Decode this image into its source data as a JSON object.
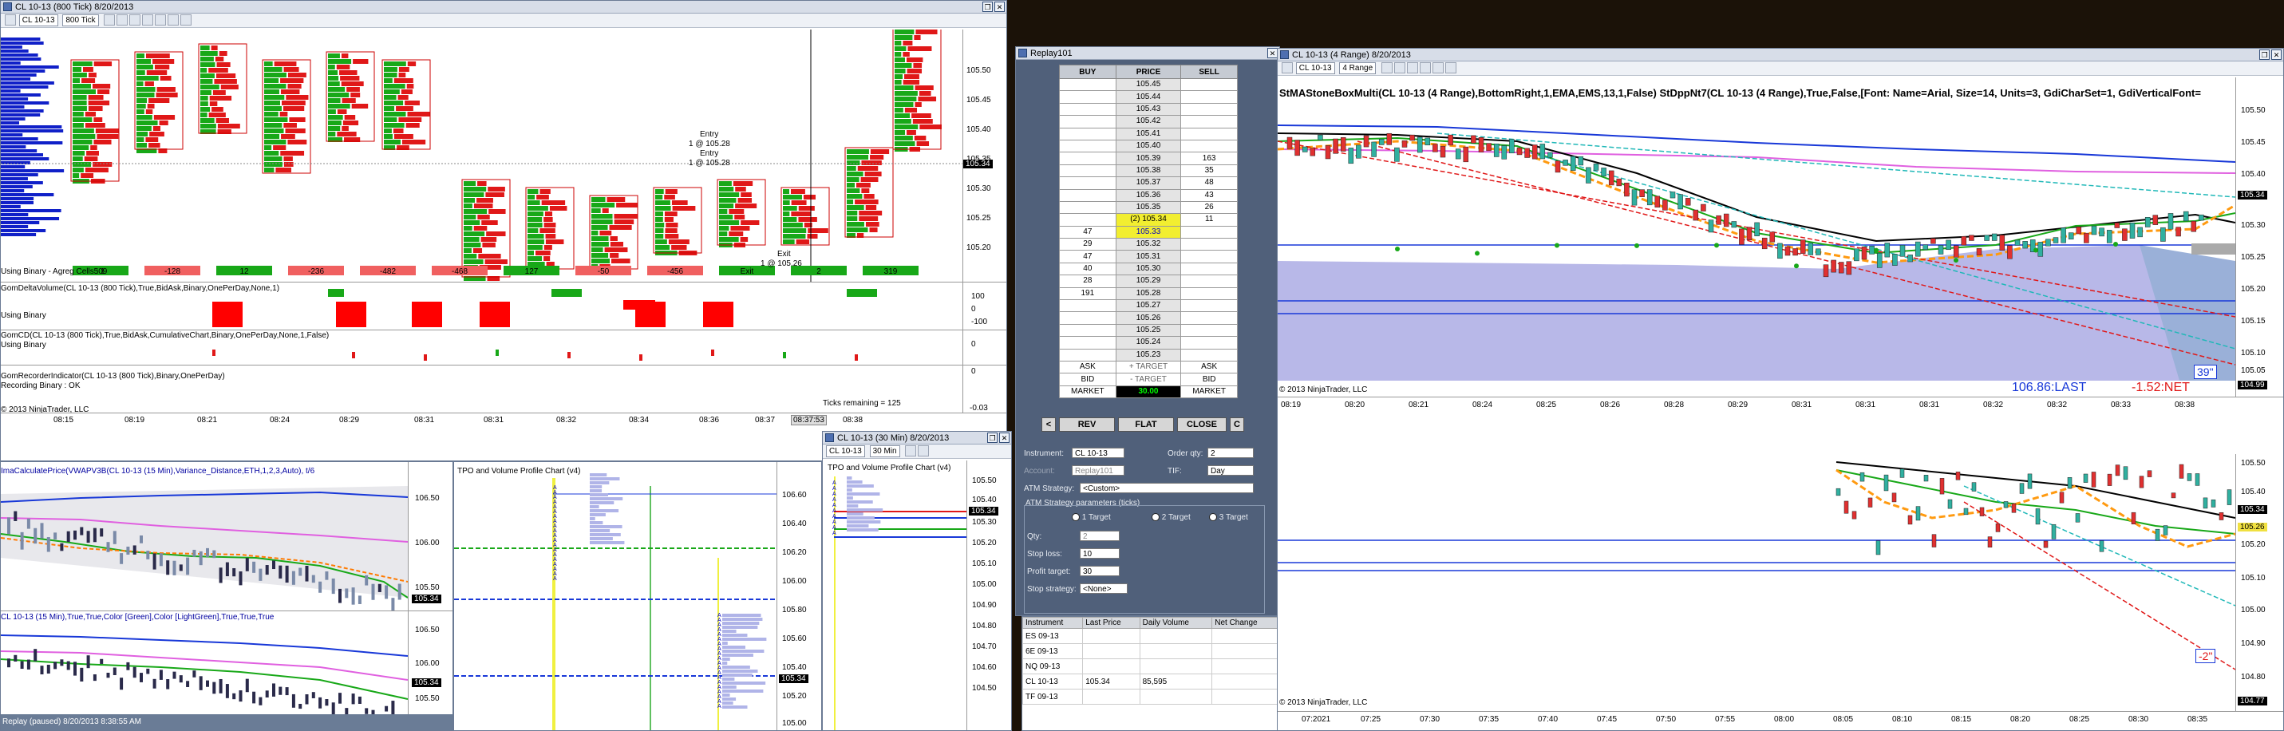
{
  "w1": {
    "title": "CL 10-13 (800 Tick)  8/20/2013",
    "instrument": "CL 10-13",
    "period": "800 Tick",
    "prices": [
      "105.50",
      "105.45",
      "105.40",
      "105.35",
      "105.30",
      "105.25",
      "105.20"
    ],
    "last_price": "105.34",
    "entry_text": [
      "Entry",
      "1 @ 105.28",
      "Entry",
      "1 @ 105.28"
    ],
    "exit_text": [
      "Exit",
      "1 @ 105.26"
    ],
    "row_label": "Using Binary - Agreg Cells : 1",
    "bar_values": [
      "509",
      "-128",
      "12",
      "-236",
      "-482",
      "-468",
      "127",
      "-50",
      "-456",
      "Exit",
      "2",
      "319"
    ],
    "ind1_label": "GomDeltaVolume(CL 10-13 (800 Tick),True,BidAsk,Binary,OnePerDay,None,1)",
    "ind1_sub": "Using Binary",
    "ind1_axis": [
      "100",
      "0",
      "-100"
    ],
    "ind2_label": "GomCD(CL 10-13 (800 Tick),True,BidAsk,CumulativeChart,Binary,OnePerDay,None,1,False)",
    "ind2_sub": "Using Binary",
    "ind2_axis": [
      "0"
    ],
    "ind3_label": "GomRecorderIndicator(CL 10-13 (800 Tick),Binary,OnePerDay)",
    "ind3_sub": "Recording Binary : OK",
    "ticks_remaining": "Ticks remaining = 125",
    "copyright": "© 2013 NinjaTrader, LLC",
    "ind3_axis": [
      "0",
      "-0.03"
    ],
    "times": [
      "08:15",
      "08:19",
      "08:21",
      "08:24",
      "08:29",
      "08:31",
      "08:31",
      "08:32",
      "08:34",
      "08:36",
      "08:37",
      "08:38"
    ],
    "cursor_time": "08:37:53"
  },
  "w2": {
    "title": "CL 10-13 (15 Min)",
    "label": "ImaCalculatePrice(VWAPV3B(CL 10-13 (15 Min),Variance_Distance,ETH,1,2,3,Auto),  t/6",
    "prices": [
      "106.50",
      "106.00",
      "105.50"
    ],
    "last_price": "105.34",
    "label2": "CL 10-13 (15 Min),True,True,Color [Green],Color [LightGreen],True,True,True",
    "prices2": [
      "106.50",
      "106.00",
      "105.50"
    ],
    "last_price2": "105.34",
    "status": "Replay (paused) 8/20/2013 8:38:55 AM"
  },
  "w3": {
    "label": "TPO and Volume Profile Chart (v4)",
    "prices": [
      "106.60",
      "106.40",
      "106.20",
      "106.00",
      "105.80",
      "105.60",
      "105.40",
      "105.20",
      "105.00"
    ],
    "last_price": "105.34"
  },
  "w4": {
    "title": "CL 10-13 (30 Min)  8/20/2013",
    "instrument": "CL 10-13",
    "period": "30 Min",
    "label": "TPO and Volume Profile Chart (v4)",
    "prices": [
      "105.50",
      "105.40",
      "105.30",
      "105.20",
      "105.10",
      "105.00",
      "104.90",
      "104.80",
      "104.70",
      "104.60",
      "104.50"
    ],
    "last_price": "105.34"
  },
  "replay": {
    "title": "Replay101",
    "headers": [
      "BUY",
      "PRICE",
      "SELL"
    ],
    "rows": [
      {
        "buy": "",
        "price": "105.45",
        "sell": ""
      },
      {
        "buy": "",
        "price": "105.44",
        "sell": ""
      },
      {
        "buy": "",
        "price": "105.43",
        "sell": ""
      },
      {
        "buy": "",
        "price": "105.42",
        "sell": ""
      },
      {
        "buy": "",
        "price": "105.41",
        "sell": ""
      },
      {
        "buy": "",
        "price": "105.40",
        "sell": ""
      },
      {
        "buy": "",
        "price": "105.39",
        "sell": "163"
      },
      {
        "buy": "",
        "price": "105.38",
        "sell": "35"
      },
      {
        "buy": "",
        "price": "105.37",
        "sell": "48"
      },
      {
        "buy": "",
        "price": "105.36",
        "sell": "43"
      },
      {
        "buy": "",
        "price": "105.35",
        "sell": "26"
      },
      {
        "buy": "",
        "price": "(2) 105.34",
        "sell": "11"
      },
      {
        "buy": "47",
        "price": "105.33",
        "sell": ""
      },
      {
        "buy": "29",
        "price": "105.32",
        "sell": ""
      },
      {
        "buy": "47",
        "price": "105.31",
        "sell": ""
      },
      {
        "buy": "40",
        "price": "105.30",
        "sell": ""
      },
      {
        "buy": "28",
        "price": "105.29",
        "sell": ""
      },
      {
        "buy": "191",
        "price": "105.28",
        "sell": ""
      },
      {
        "buy": "",
        "price": "105.27",
        "sell": ""
      },
      {
        "buy": "",
        "price": "105.26",
        "sell": ""
      },
      {
        "buy": "",
        "price": "105.25",
        "sell": ""
      },
      {
        "buy": "",
        "price": "105.24",
        "sell": ""
      },
      {
        "buy": "",
        "price": "105.23",
        "sell": ""
      }
    ],
    "ask_label": "ASK",
    "target_label": "+ TARGET",
    "bid_label": "BID",
    "target_label2": "- TARGET",
    "market_label": "MARKET",
    "position": "30.00",
    "rev": "REV",
    "flat": "FLAT",
    "close": "CLOSE",
    "left_arrow": "<",
    "c_label": "C",
    "instrument_label": "Instrument:",
    "instrument": "CL 10-13",
    "order_qty_label": "Order qty:",
    "order_qty": "2",
    "account_label": "Account:",
    "account": "Replay101",
    "tif_label": "TIF:",
    "tif": "Day",
    "atm_label": "ATM Strategy:",
    "atm": "<Custom>",
    "atm_params": "ATM Strategy parameters (ticks)",
    "targets": [
      "1 Target",
      "2 Target",
      "3 Target"
    ],
    "qty_label": "Qty:",
    "qty": "2",
    "stop_label": "Stop loss:",
    "stop": "10",
    "profit_label": "Profit target:",
    "profit": "30",
    "stopstrat_label": "Stop strategy:",
    "stopstrat": "<None>"
  },
  "quotes": {
    "headers": [
      "Instrument",
      "Last Price",
      "Daily Volume",
      "Net Change"
    ],
    "rows": [
      {
        "inst": "ES 09-13",
        "last": "",
        "vol": ""
      },
      {
        "inst": "6E 09-13",
        "last": "",
        "vol": ""
      },
      {
        "inst": "NQ 09-13",
        "last": "",
        "vol": ""
      },
      {
        "inst": "CL 10-13",
        "last": "105.34",
        "vol": "85,595"
      },
      {
        "inst": "TF 09-13",
        "last": "",
        "vol": ""
      }
    ]
  },
  "w6": {
    "title": "CL 10-13 (4 Range)  8/20/2013",
    "instrument": "CL 10-13",
    "period": "4 Range",
    "label": "StMAStoneBoxMulti(CL 10-13 (4 Range),BottomRight,1,EMA,EMS,13,1,False)   StDppNt7(CL 10-13 (4 Range),True,False,[Font: Name=Arial, Size=14, Units=3,  GdiCharSet=1, GdiVerticalFont=",
    "prices": [
      "105.50",
      "105.45",
      "105.40",
      "105.35",
      "105.30",
      "105.25",
      "105.20",
      "105.15",
      "105.10",
      "105.05",
      "104.99"
    ],
    "last_price": "105.34",
    "bottom_price": "104.99",
    "times": [
      "08:19",
      "08:20",
      "08:21",
      "08:24",
      "08:25",
      "08:26",
      "08:28",
      "08:29",
      "08:31",
      "08:31",
      "08:31",
      "08:32",
      "08:32",
      "08:33",
      "08:38"
    ],
    "last_text": "106.86:LAST",
    "net_text": "-1.52:NET",
    "timer": "39\"",
    "copyright": "© 2013 NinjaTrader, LLC",
    "prices2": [
      "105.50",
      "105.40",
      "105.34",
      "105.26",
      "105.20",
      "105.10",
      "105.00",
      "104.90",
      "104.80",
      "104.77"
    ],
    "timer2": "-2\"",
    "copyright2": "© 2013 NinjaTrader, LLC",
    "times2": [
      "07:2021",
      "07:25",
      "07:30",
      "07:35",
      "07:40",
      "07:45",
      "07:50",
      "07:55",
      "08:00",
      "08:05",
      "08:10",
      "08:15",
      "08:20",
      "08:25",
      "08:30",
      "08:35"
    ]
  },
  "colors": {
    "up": "#18a818",
    "down": "#e01818",
    "vol_blue": "#1428c8",
    "panel_bg": "#50607a",
    "last_bg": "#000000"
  }
}
